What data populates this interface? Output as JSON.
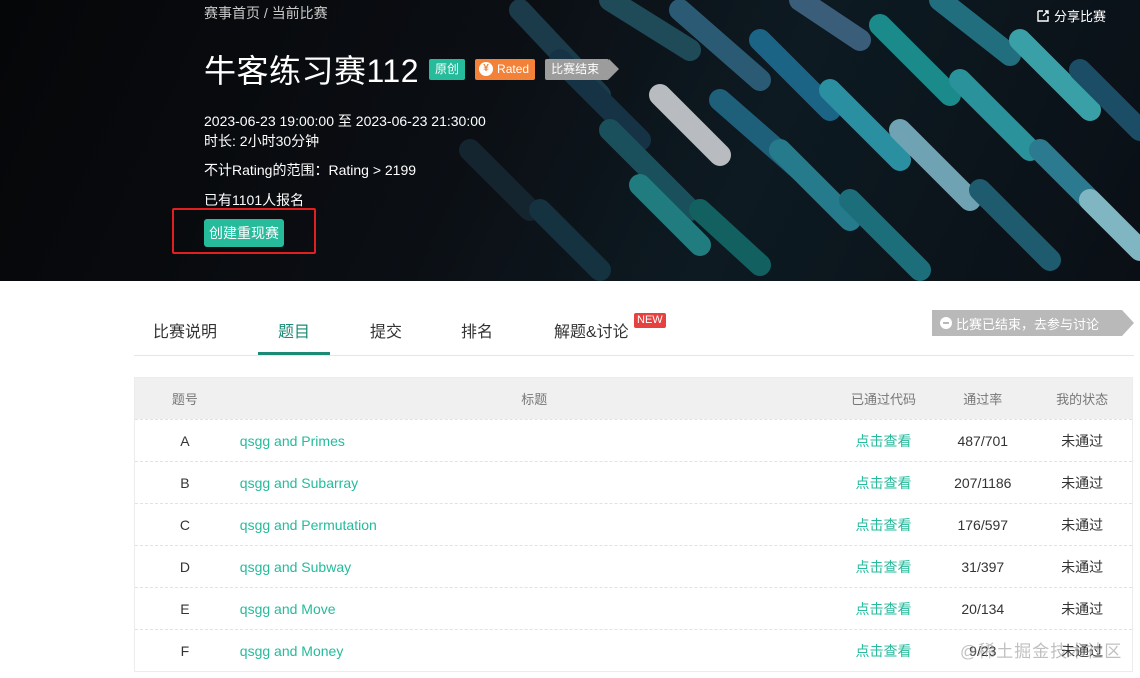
{
  "breadcrumb": {
    "home": "赛事首页",
    "separator": " / ",
    "current": "当前比赛"
  },
  "share": {
    "icon": "share-icon",
    "label": "分享比赛"
  },
  "contest": {
    "title": "牛客练习赛112",
    "tags": {
      "original": "原创",
      "rated": "Rated",
      "ended": "比赛结束"
    },
    "time_range": "2023-06-23 19:00:00 至 2023-06-23 21:30:00",
    "duration": "时长: 2小时30分钟",
    "rating_range": "不计Rating的范围：Rating > 2199",
    "signup_count": "已有1101人报名",
    "replay_button": "创建重现赛"
  },
  "tabs": [
    {
      "label": "比赛说明"
    },
    {
      "label": "题目"
    },
    {
      "label": "提交"
    },
    {
      "label": "排名"
    },
    {
      "label": "解题&讨论"
    }
  ],
  "new_badge": "NEW",
  "discuss_button": "比赛已结束，去参与讨论",
  "table": {
    "headers": {
      "id": "题号",
      "title": "标题",
      "code": "已通过代码",
      "rate": "通过率",
      "status": "我的状态"
    },
    "rows": [
      {
        "id": "A",
        "title": "qsgg and Primes",
        "code": "点击查看",
        "rate": "487/701",
        "status": "未通过"
      },
      {
        "id": "B",
        "title": "qsgg and Subarray",
        "code": "点击查看",
        "rate": "207/1186",
        "status": "未通过"
      },
      {
        "id": "C",
        "title": "qsgg and Permutation",
        "code": "点击查看",
        "rate": "176/597",
        "status": "未通过"
      },
      {
        "id": "D",
        "title": "qsgg and Subway",
        "code": "点击查看",
        "rate": "31/397",
        "status": "未通过"
      },
      {
        "id": "E",
        "title": "qsgg and Move",
        "code": "点击查看",
        "rate": "20/134",
        "status": "未通过"
      },
      {
        "id": "F",
        "title": "qsgg and Money",
        "code": "点击查看",
        "rate": "9/23",
        "status": "未通过"
      }
    ]
  },
  "watermark": "@稀土掘金技术社区",
  "colors": {
    "accent": "#25bb9b",
    "active_tab": "#1c8b76",
    "rated": "#f38137",
    "highlight": "#e02020"
  }
}
